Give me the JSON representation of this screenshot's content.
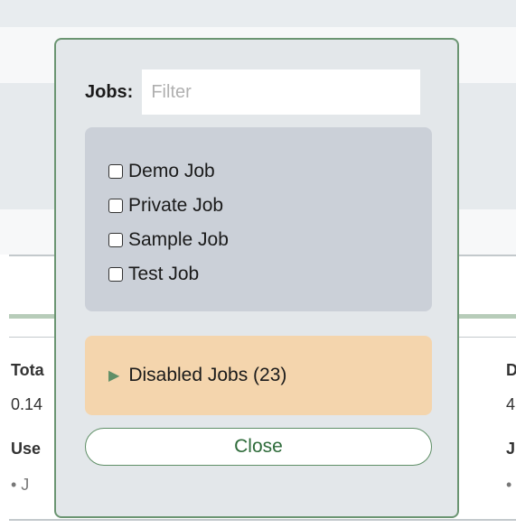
{
  "background": {
    "left_col": {
      "total_label": "Tota",
      "total_value": "0.14",
      "used_label": "Use",
      "bullet_text": "•   J"
    },
    "right_col": {
      "label": "D",
      "value": "4",
      "label2": "J",
      "bullet": "•"
    }
  },
  "modal": {
    "filter_label": "Jobs:",
    "filter_placeholder": "Filter",
    "jobs": [
      {
        "label": "Demo Job",
        "checked": false
      },
      {
        "label": "Private Job",
        "checked": false
      },
      {
        "label": "Sample Job",
        "checked": false
      },
      {
        "label": "Test Job",
        "checked": false
      }
    ],
    "disabled_label": "Disabled Jobs (23)",
    "close_label": "Close"
  },
  "colors": {
    "modal_border": "#6b9572",
    "jobs_box": "#cbd0d8",
    "disabled_box": "#f4d5ad",
    "close_text": "#2e6b3a"
  }
}
